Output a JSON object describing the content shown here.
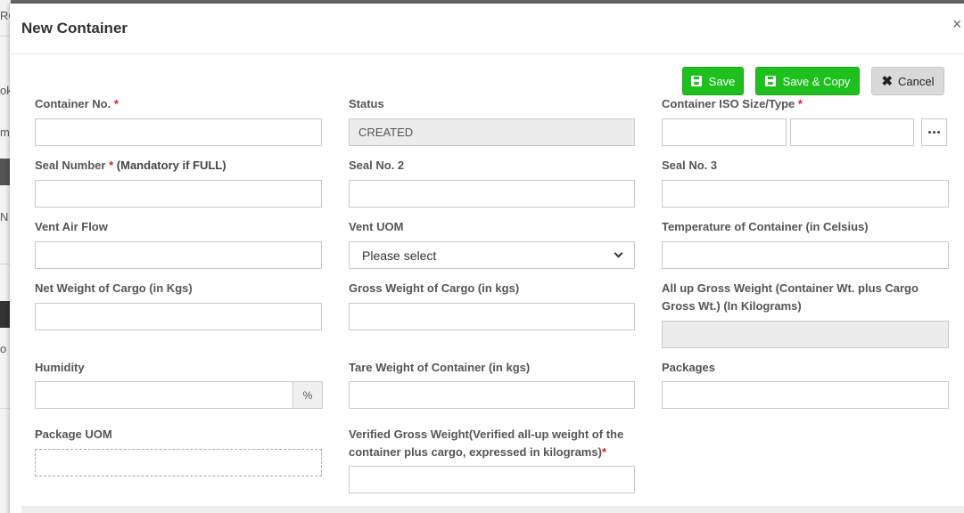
{
  "modal": {
    "title": "New Container",
    "close": "×"
  },
  "actions": {
    "save": "Save",
    "save_copy": "Save & Copy",
    "cancel": "Cancel"
  },
  "form": {
    "container_no": {
      "label": "Container No.",
      "required": "*",
      "value": ""
    },
    "status": {
      "label": "Status",
      "value": "CREATED"
    },
    "iso": {
      "label": "Container ISO Size/Type",
      "required": "*",
      "size": "",
      "type": ""
    },
    "seal_number": {
      "label": "Seal Number",
      "required": "*",
      "note": "(Mandatory if FULL)",
      "value": ""
    },
    "seal_no_2": {
      "label": "Seal No. 2",
      "value": ""
    },
    "seal_no_3": {
      "label": "Seal No. 3",
      "value": ""
    },
    "vent_air_flow": {
      "label": "Vent Air Flow",
      "value": ""
    },
    "vent_uom": {
      "label": "Vent UOM",
      "selected": "Please select"
    },
    "temperature": {
      "label": "Temperature of Container (in Celsius)",
      "value": ""
    },
    "net_weight": {
      "label": "Net Weight of Cargo (in Kgs)",
      "value": ""
    },
    "gross_weight": {
      "label": "Gross Weight of Cargo (in kgs)",
      "value": ""
    },
    "all_up_gross": {
      "label_line1": "All up Gross Weight (Container Wt. plus Cargo",
      "label_line2": "Gross Wt.) (In Kilograms)",
      "value": ""
    },
    "humidity": {
      "label": "Humidity",
      "value": "",
      "addon": "%"
    },
    "tare_weight": {
      "label": "Tare Weight of Container (in kgs)",
      "value": ""
    },
    "packages": {
      "label": "Packages",
      "value": ""
    },
    "package_uom": {
      "label": "Package UOM"
    },
    "vgm": {
      "label_line1": "Verified Gross Weight(Verified all-up weight of the",
      "label_line2": "container plus cargo, expressed in kilograms)",
      "required": "*",
      "value": ""
    }
  },
  "background": {
    "fragments": [
      "RC",
      "ok",
      "m",
      "N",
      "o"
    ]
  }
}
